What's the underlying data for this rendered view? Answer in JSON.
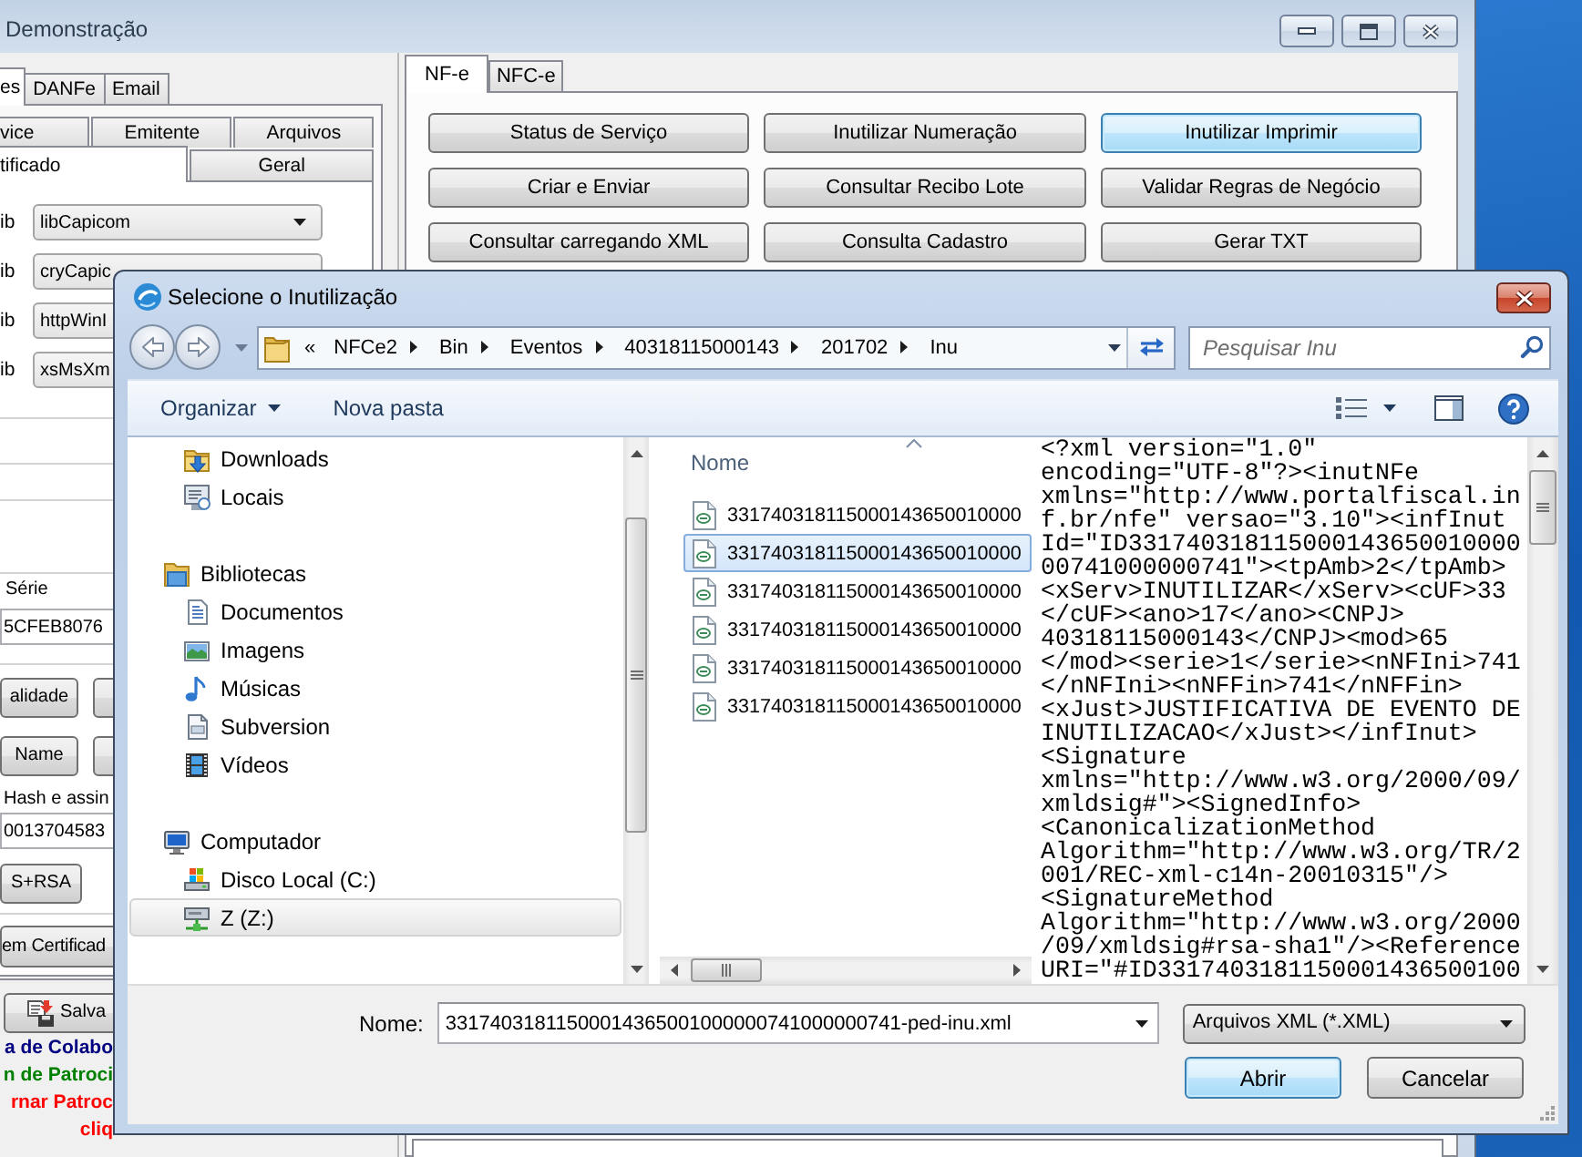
{
  "main_window": {
    "title": "Demonstração",
    "left_panel": {
      "tabs": [
        {
          "label": "es",
          "selected": true
        },
        {
          "label": "DANFe",
          "selected": false
        },
        {
          "label": "Email",
          "selected": false
        }
      ],
      "subtab_rows": [
        [
          {
            "label": "vice",
            "selected": false
          },
          {
            "label": "Emitente",
            "selected": false
          },
          {
            "label": "Arquivos",
            "selected": false
          }
        ],
        [
          {
            "label": "tificado",
            "selected": true
          },
          {
            "label": "Geral",
            "selected": false
          }
        ]
      ],
      "libraries": [
        {
          "label": "ib",
          "value": "libCapicom"
        },
        {
          "label": "ib",
          "value": "cryCapic"
        },
        {
          "label": "ib",
          "value": "httpWinI"
        },
        {
          "label": "ib",
          "value": "xsMsXm"
        }
      ],
      "serial": {
        "label": "Série",
        "value": "5CFEB8076"
      },
      "certificate_buttons": [
        "alidade",
        "Name"
      ],
      "hash": {
        "label": "Hash e assin",
        "value": "0013704583"
      },
      "sign_button": "S+RSA",
      "load_button": "em Certificad",
      "save_button": "Salva",
      "links": [
        {
          "text": "a de Colabo",
          "color": "#000080"
        },
        {
          "text": "n de Patroci",
          "color": "#008000"
        },
        {
          "text": "rnar Patroc",
          "color": "#ff0000"
        },
        {
          "text": "cliq",
          "color": "#ff0000"
        }
      ]
    },
    "right_panel": {
      "tabs": [
        {
          "label": "NF-e",
          "selected": true
        },
        {
          "label": "NFC-e",
          "selected": false
        }
      ],
      "buttons": [
        {
          "label": "Status de Serviço",
          "focused": false
        },
        {
          "label": "Inutilizar Numeração",
          "focused": false
        },
        {
          "label": "Inutilizar Imprimir",
          "focused": true
        },
        {
          "label": "Criar e Enviar",
          "focused": false
        },
        {
          "label": "Consultar Recibo Lote",
          "focused": false
        },
        {
          "label": "Validar Regras de Negócio",
          "focused": false
        },
        {
          "label": "Consultar carregando XML",
          "focused": false
        },
        {
          "label": "Consulta Cadastro",
          "focused": false
        },
        {
          "label": "Gerar TXT",
          "focused": false
        }
      ]
    }
  },
  "dialog": {
    "title": "Selecione o Inutilização",
    "breadcrumb": {
      "overflow": "«",
      "items": [
        "NFCe2",
        "Bin",
        "Eventos",
        "40318115000143",
        "201702",
        "Inu"
      ]
    },
    "search": {
      "placeholder": "Pesquisar Inu"
    },
    "toolbar": {
      "organize": "Organizar",
      "new_folder": "Nova pasta"
    },
    "nav": [
      {
        "children": [
          {
            "label": "Downloads",
            "kind": "downloads",
            "selected": false
          },
          {
            "label": "Locais",
            "kind": "recent",
            "selected": false
          }
        ]
      },
      {
        "label": "Bibliotecas",
        "kind": "library",
        "selected": false,
        "children": [
          {
            "label": "Documentos",
            "kind": "documents",
            "selected": false
          },
          {
            "label": "Imagens",
            "kind": "pictures",
            "selected": false
          },
          {
            "label": "Músicas",
            "kind": "music",
            "selected": false
          },
          {
            "label": "Subversion",
            "kind": "document",
            "selected": false
          },
          {
            "label": "Vídeos",
            "kind": "videos",
            "selected": false
          }
        ]
      },
      {
        "label": "Computador",
        "kind": "computer",
        "selected": false,
        "children": [
          {
            "label": "Disco Local (C:)",
            "kind": "drive",
            "selected": false
          },
          {
            "label": "Z (Z:)",
            "kind": "network_drive",
            "selected": true
          }
        ]
      }
    ],
    "files": {
      "column": "Nome",
      "rows": [
        {
          "name": "331740318115000143650010000",
          "selected": false
        },
        {
          "name": "331740318115000143650010000",
          "selected": true
        },
        {
          "name": "331740318115000143650010000",
          "selected": false
        },
        {
          "name": "331740318115000143650010000",
          "selected": false
        },
        {
          "name": "331740318115000143650010000",
          "selected": false
        },
        {
          "name": "331740318115000143650010000",
          "selected": false
        }
      ]
    },
    "preview": {
      "lines": [
        "<?xml version=\"1.0\"",
        "encoding=\"UTF-8\"?><inutNFe",
        "xmlns=\"http://www.portalfiscal.in",
        "f.br/nfe\" versao=\"3.10\"><infInut",
        "Id=\"ID331740318115000143650010000",
        "00741000000741\"><tpAmb>2</tpAmb>",
        "<xServ>INUTILIZAR</xServ><cUF>33",
        "</cUF><ano>17</ano><CNPJ>",
        "40318115000143</CNPJ><mod>65",
        "</mod><serie>1</serie><nNFIni>741",
        "</nNFIni><nNFFin>741</nNFFin>",
        "<xJust>JUSTIFICATIVA DE EVENTO DE",
        "INUTILIZACAO</xJust></infInut>",
        "<Signature",
        "xmlns=\"http://www.w3.org/2000/09/",
        "xmldsig#\"><SignedInfo>",
        "<CanonicalizationMethod",
        "Algorithm=\"http://www.w3.org/TR/2",
        "001/REC-xml-c14n-20010315\"/>",
        "<SignatureMethod",
        "Algorithm=\"http://www.w3.org/2000",
        "/09/xmldsig#rsa-sha1\"/><Reference",
        "URI=\"#ID3317403181150001436500100"
      ]
    },
    "filename": {
      "label": "Nome:",
      "value": "33174031811500014365001000000741000000741-ped-inu.xml"
    },
    "filetype": "Arquivos XML (*.XML)",
    "buttons": [
      {
        "label": "Abrir",
        "default": true
      },
      {
        "label": "Cancelar",
        "default": false
      }
    ]
  }
}
